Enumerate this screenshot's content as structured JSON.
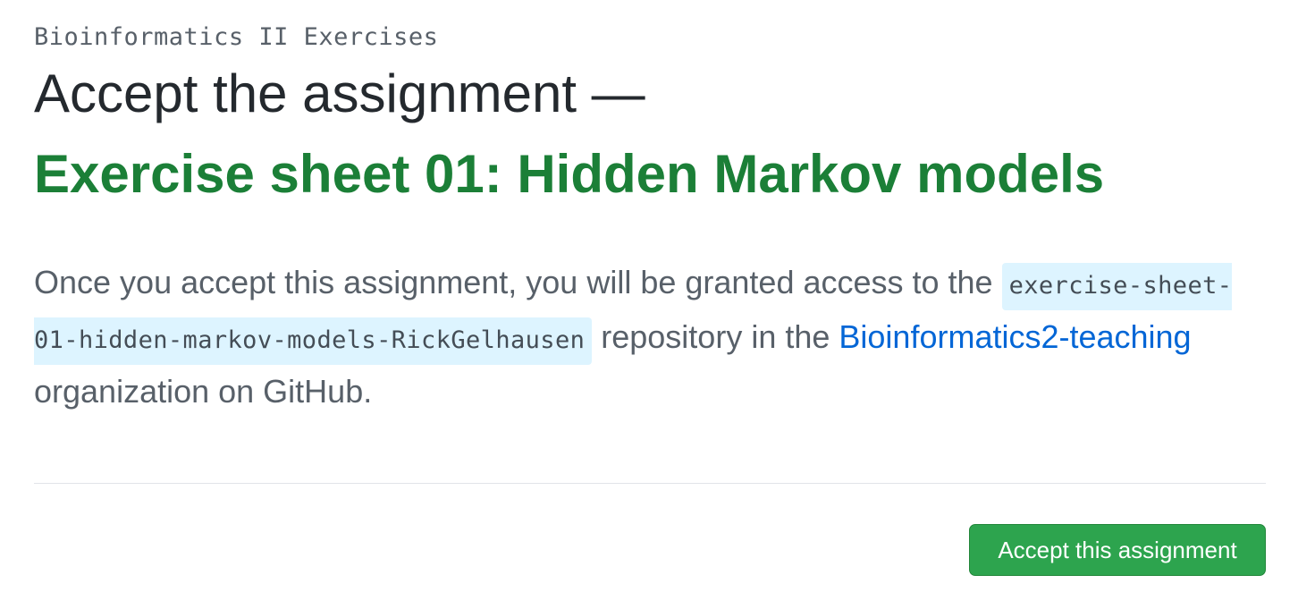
{
  "course": {
    "name": "Bioinformatics II Exercises"
  },
  "heading": {
    "text": "Accept the assignment —"
  },
  "assignment": {
    "title": "Exercise sheet 01: Hidden Markov models"
  },
  "description": {
    "intro": "Once you accept this assignment, you will be granted access to the ",
    "repo_name": "exercise-sheet-01-hidden-markov-models-RickGelhausen",
    "middle": " repository in the ",
    "org_name": "Bioinformatics2-teaching",
    "outro": " organization on GitHub."
  },
  "actions": {
    "accept_label": "Accept this assignment"
  },
  "colors": {
    "title_green": "#1b7f37",
    "link_blue": "#0366d6",
    "button_green": "#2da44e",
    "code_bg": "#ddf4ff"
  }
}
